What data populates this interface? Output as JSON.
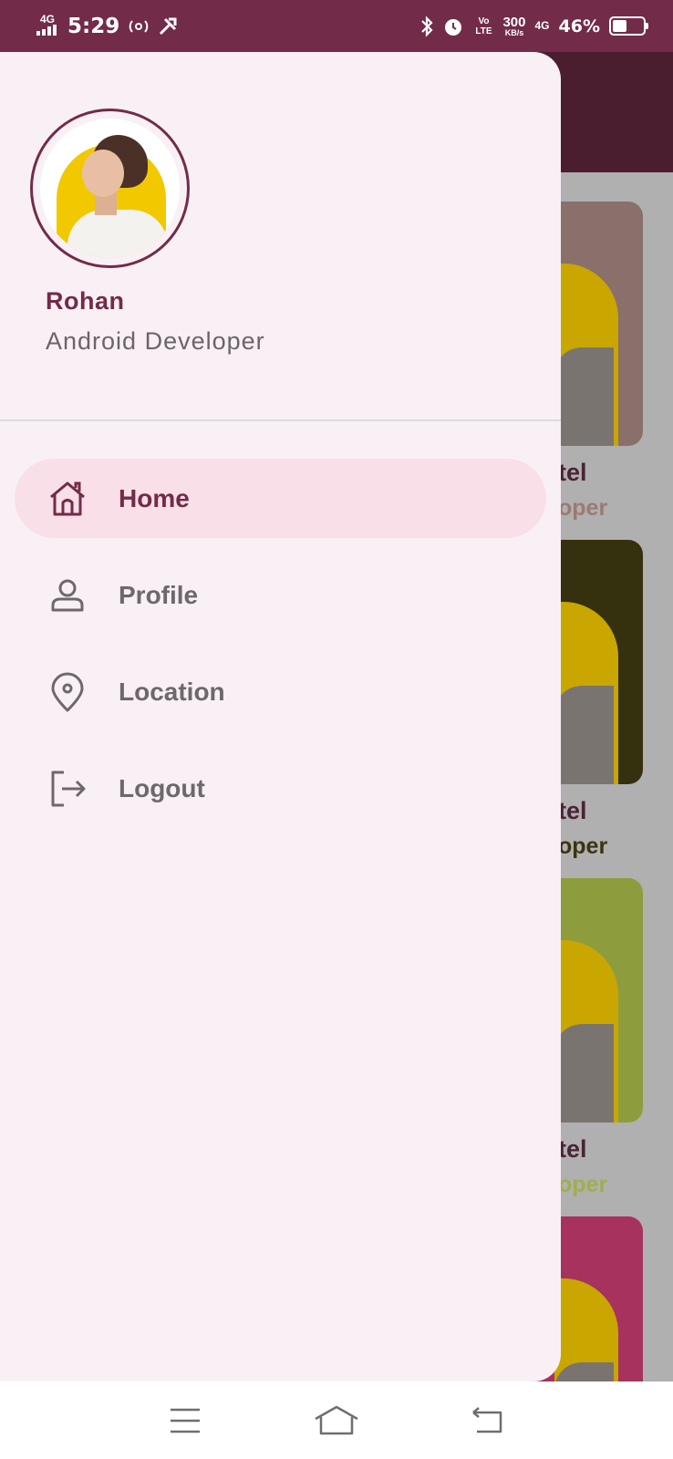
{
  "status_bar": {
    "network": "4G",
    "time": "5:29",
    "volte": "Vo LTE",
    "speed_value": "300",
    "speed_unit": "KB/s",
    "network2": "4G",
    "battery_percent": "46%",
    "battery_level": 0.46
  },
  "drawer": {
    "user": {
      "name": "Rohan",
      "role": "Android Developer"
    },
    "menu": [
      {
        "label": "Home",
        "icon": "home-icon",
        "active": true
      },
      {
        "label": "Profile",
        "icon": "person-icon",
        "active": false
      },
      {
        "label": "Location",
        "icon": "location-pin-icon",
        "active": false
      },
      {
        "label": "Logout",
        "icon": "logout-icon",
        "active": false
      }
    ]
  },
  "background_list": {
    "cards": [
      {
        "name_fragment": "tel",
        "role_fragment": "oper",
        "card_color": "#8a706b",
        "role_color": "#9c7a72"
      },
      {
        "name_fragment": "tel",
        "role_fragment": "oper",
        "card_color": "#35300d",
        "role_color": "#3a3410"
      },
      {
        "name_fragment": "tel",
        "role_fragment": "oper",
        "card_color": "#8d9d3d",
        "role_color": "#a2ae4c"
      },
      {
        "card_color": "#a8325e"
      }
    ]
  },
  "nav_bar": {
    "buttons": [
      "menu-icon",
      "home-outline-icon",
      "back-icon"
    ]
  },
  "colors": {
    "primary": "#722b49",
    "drawer_bg": "#f9f0f6",
    "active_item_bg": "#f8dfe8"
  }
}
